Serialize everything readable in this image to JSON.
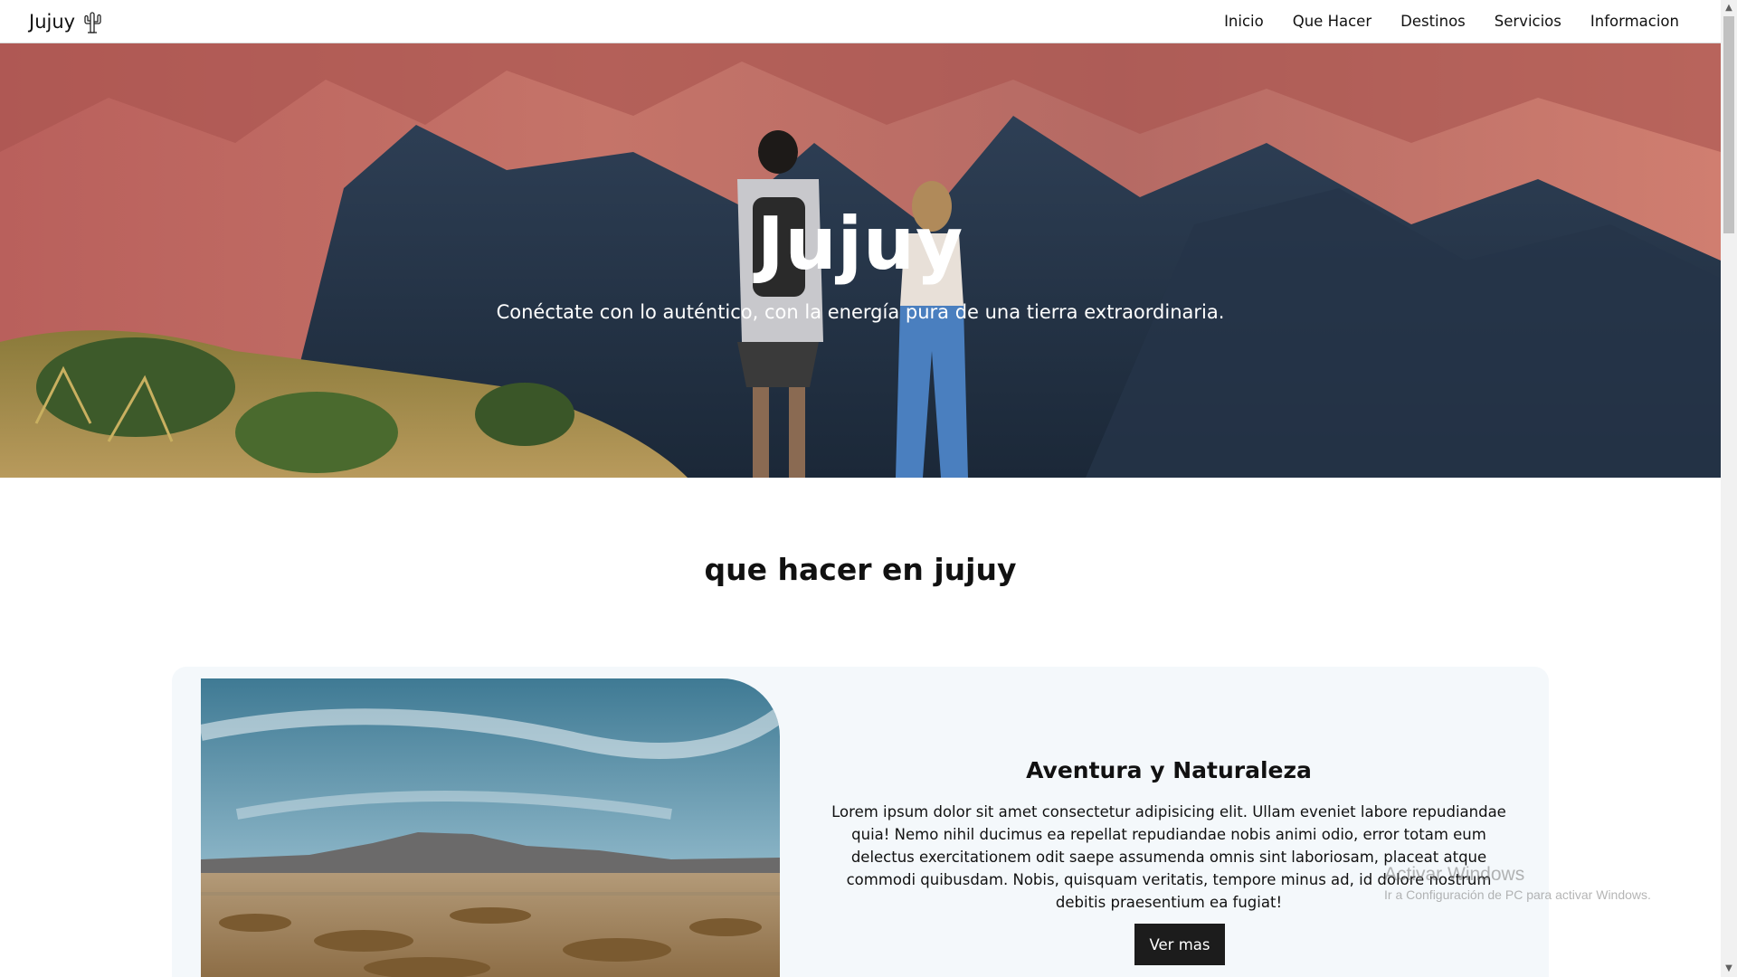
{
  "navbar": {
    "brand": "Jujuy",
    "brand_icon": "cactus-icon",
    "links": [
      "Inicio",
      "Que Hacer",
      "Destinos",
      "Servicios",
      "Informacion"
    ]
  },
  "hero": {
    "title": "Jujuy",
    "subtitle": "Conéctate con lo auténtico, con la energía pura de una tierra extraordinaria."
  },
  "section": {
    "title": "que hacer en jujuy"
  },
  "card": {
    "title": "Aventura y Naturaleza",
    "text": "Lorem ipsum dolor sit amet consectetur adipisicing elit. Ullam eveniet labore repudiandae quia! Nemo nihil ducimus ea repellat repudiandae nobis animi odio, error totam eum delectus exercitationem odit saepe assumenda omnis sint laboriosam, placeat atque commodi quibusdam. Nobis, quisquam veritatis, tempore minus ad, id dolore nostrum debitis praesentium ea fugiat!",
    "button": "Ver mas"
  },
  "watermark": {
    "title": "Activar Windows",
    "subtitle": "Ir a Configuración de PC para activar Windows."
  },
  "colors": {
    "navbar_bg": "#ffffff",
    "card_bg": "#f4f8fb",
    "button_bg": "#1c1c1c",
    "text": "#111111"
  }
}
